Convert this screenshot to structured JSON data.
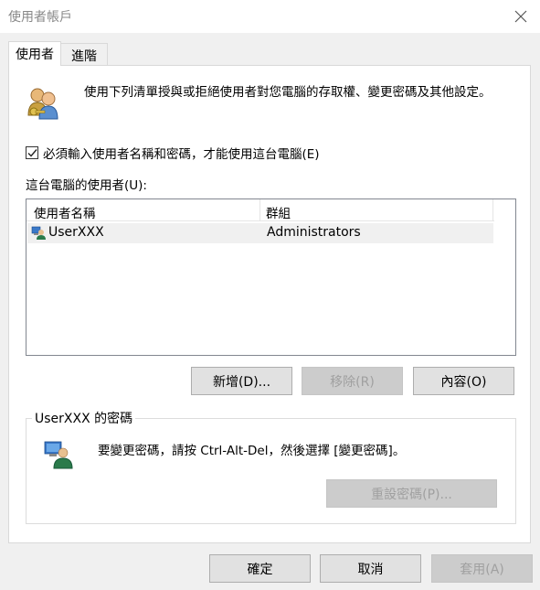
{
  "window": {
    "title": "使用者帳戶",
    "close_icon": "close-icon"
  },
  "tabs": [
    {
      "label": "使用者",
      "active": true
    },
    {
      "label": "進階",
      "active": false
    }
  ],
  "users_tab": {
    "description": "使用下列清單授與或拒絕使用者對您電腦的存取權、變更密碼及其他設定。",
    "require_login_checkbox": {
      "label": "必須輸入使用者名稱和密碼，才能使用這台電腦(E)",
      "checked": true
    },
    "users_list_label": "這台電腦的使用者(U):",
    "list_columns": [
      "使用者名稱",
      "群組"
    ],
    "list_rows": [
      {
        "name": "UserXXX",
        "group": "Administrators"
      }
    ],
    "buttons": {
      "add": "新增(D)...",
      "remove": "移除(R)",
      "properties": "內容(O)"
    },
    "password_group": {
      "title": "UserXXX 的密碼",
      "text": "要變更密碼，請按 Ctrl-Alt-Del，然後選擇 [變更密碼]。",
      "reset_button": "重設密碼(P)..."
    }
  },
  "footer": {
    "ok": "確定",
    "cancel": "取消",
    "apply": "套用(A)"
  }
}
